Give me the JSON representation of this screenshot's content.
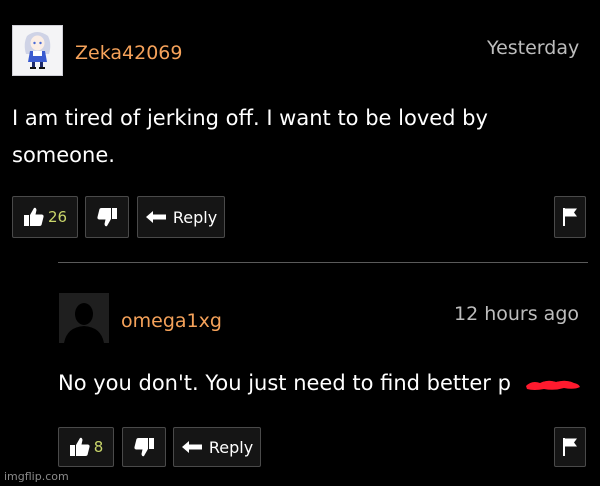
{
  "comments": [
    {
      "username": "Zeka42069",
      "timestamp": "Yesterday",
      "text_line1": "I am tired of jerking off. I want to be loved by",
      "text_line2": "someone.",
      "like_count": "26",
      "reply_label": "Reply"
    },
    {
      "username": "omega1xg",
      "timestamp": "12 hours ago",
      "text": "No you don't. You just need to find better p",
      "like_count": "8",
      "reply_label": "Reply"
    }
  ],
  "watermark": "imgflip.com",
  "colors": {
    "username": "#f5a25a",
    "like_count": "#c9d66a",
    "timestamp": "#bdbdbd",
    "redaction": "#ff1a2e"
  },
  "icons": {
    "like": "thumbs-up-icon",
    "dislike": "thumbs-down-icon",
    "reply": "reply-arrow-icon",
    "flag": "flag-icon"
  }
}
